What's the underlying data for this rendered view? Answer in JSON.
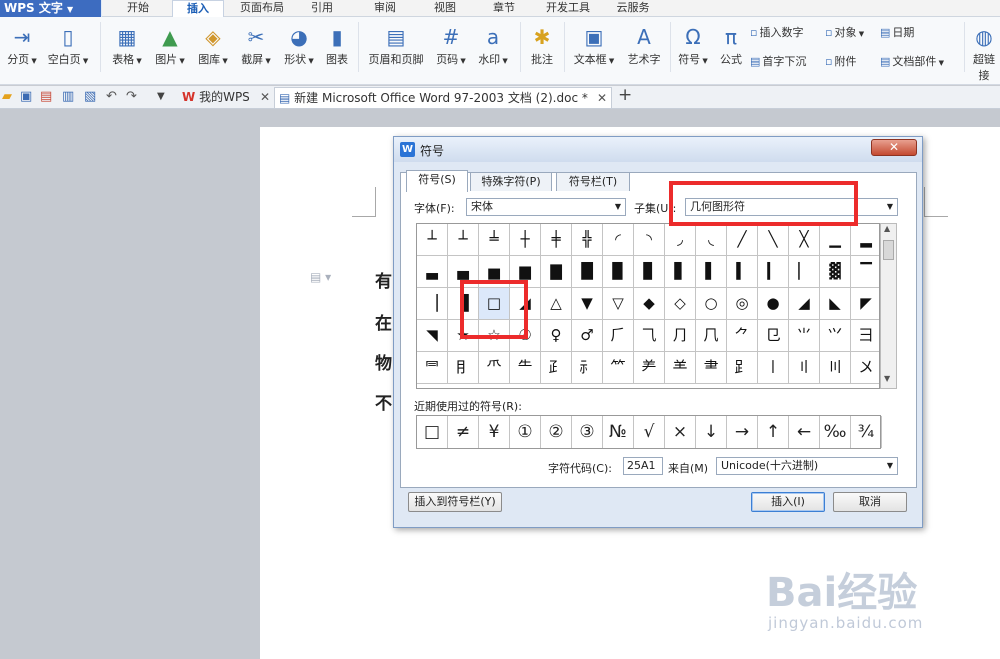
{
  "app": {
    "name": "WPS 文字"
  },
  "menu_tabs": [
    "开始",
    "插入",
    "页面布局",
    "引用",
    "审阅",
    "视图",
    "章节",
    "开发工具",
    "云服务"
  ],
  "active_menu_tab": "插入",
  "ribbon": {
    "buttons": [
      "分页",
      "空白页",
      "表格",
      "图片",
      "图库",
      "截屏",
      "形状",
      "图表",
      "页眉和页脚",
      "页码",
      "水印",
      "批注",
      "文本框",
      "艺术字",
      "符号",
      "公式",
      "超链接"
    ],
    "small": [
      "插入数字",
      "对象",
      "日期",
      "首字下沉",
      "附件",
      "文档部件"
    ]
  },
  "doc_tabs": {
    "home": "我的WPS",
    "active": "新建 Microsoft Office Word 97-2003 文档 (2).doc *",
    "add": "+"
  },
  "page_text": [
    "有",
    "在",
    "物",
    "不"
  ],
  "dialog": {
    "title": "符号",
    "close": "✕",
    "tabs": [
      "符号(S)",
      "特殊字符(P)",
      "符号栏(T)"
    ],
    "font_label": "字体(F):",
    "font_value": "宋体",
    "subset_label": "子集(U):",
    "subset_value": "几何图形符",
    "symbol_rows": [
      [
        "┴",
        "┴",
        "╧",
        "┼",
        "╪",
        "╬",
        "◜",
        "◝",
        "◞",
        "◟",
        "╱",
        "╲",
        "╳",
        "▁",
        "▂"
      ],
      [
        "▃",
        "▄",
        "▅",
        "▆",
        "▇",
        "█",
        "▉",
        "▊",
        "▋",
        "▌",
        "▍",
        "▎",
        "▏",
        "▓",
        "▔"
      ],
      [
        "▕",
        "▐",
        "□",
        "◢",
        "△",
        "▼",
        "▽",
        "◆",
        "◇",
        "○",
        "◎",
        "●",
        "◢",
        "◣",
        "◤"
      ],
      [
        "◥",
        "★",
        "☆",
        "☉",
        "♀",
        "♂",
        "⺁",
        "⺄",
        "⺆",
        "⺇",
        "⺈",
        "⺋",
        "⺌",
        "⺍",
        "⺕"
      ],
      [
        "⺜",
        "⺝",
        "⺥",
        "⺧",
        "⺪",
        "⺬",
        "⺮",
        "⺶",
        "⺷",
        "⺻",
        "⻊",
        "〡",
        "〢",
        "〣",
        "〤"
      ]
    ],
    "recent_label": "近期使用过的符号(R):",
    "recent": [
      "□",
      "≠",
      "¥",
      "①",
      "②",
      "③",
      "№",
      "√",
      "×",
      "↓",
      "→",
      "↑",
      "←",
      "‰",
      "¾"
    ],
    "code_label": "字符代码(C):",
    "code_value": "25A1",
    "from_label": "来自(M)",
    "from_value": "Unicode(十六进制)",
    "insert_to_bar": "插入到符号栏(Y)",
    "insert": "插入(I)",
    "cancel": "取消"
  },
  "watermark": {
    "logo": "Bai经验",
    "url": "jingyan.baidu.com"
  }
}
